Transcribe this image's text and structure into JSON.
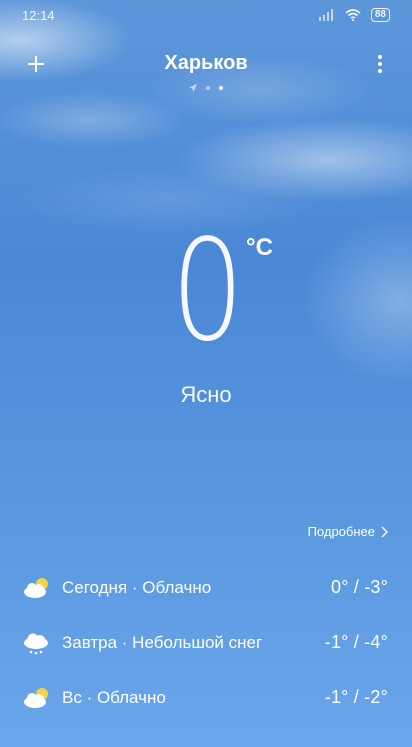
{
  "status": {
    "time": "12:14",
    "battery": "88"
  },
  "header": {
    "city": "Харьков",
    "add_label": "+",
    "more_label": "⋮"
  },
  "current": {
    "temperature": "0",
    "unit": "°C",
    "condition": "Ясно"
  },
  "details_link": "Подробнее",
  "forecast": [
    {
      "label": "Сегодня · Облачно",
      "temps": "0° / -3°",
      "icon": "partly-cloudy-icon"
    },
    {
      "label": "Завтра · Небольшой снег",
      "temps": "-1° / -4°",
      "icon": "light-snow-icon"
    },
    {
      "label": "Вс · Облачно",
      "temps": "-1° / -2°",
      "icon": "partly-cloudy-icon"
    }
  ],
  "colors": {
    "sky_top": "#5d97da",
    "sky_bottom": "#6aa6ea",
    "sun": "#f6d246"
  }
}
